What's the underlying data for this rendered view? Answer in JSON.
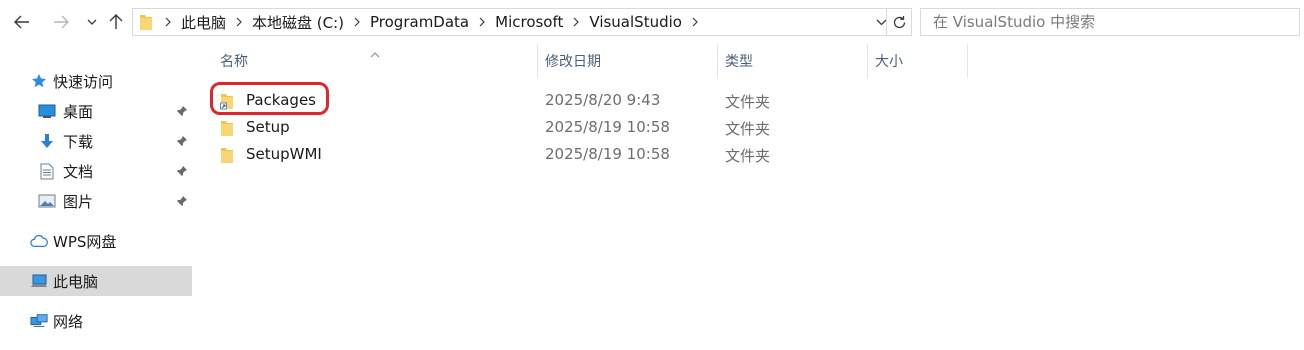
{
  "toolbar": {
    "back_icon": "back-arrow-icon",
    "forward_icon": "forward-arrow-icon",
    "recent_icon": "chevron-down-icon",
    "up_icon": "up-arrow-icon"
  },
  "address": {
    "crumbs": [
      "此电脑",
      "本地磁盘 (C:)",
      "ProgramData",
      "Microsoft",
      "VisualStudio"
    ]
  },
  "search": {
    "placeholder": "在 VisualStudio 中搜索"
  },
  "nav": {
    "quick_access": "快速访问",
    "desktop": "桌面",
    "downloads": "下载",
    "documents": "文档",
    "pictures": "图片",
    "wps": "WPS网盘",
    "this_pc": "此电脑",
    "network": "网络"
  },
  "columns": {
    "name": "名称",
    "modified": "修改日期",
    "type": "类型",
    "size": "大小"
  },
  "files": [
    {
      "name": "Packages",
      "modified": "2025/8/20 9:43",
      "type": "文件夹",
      "highlighted": true,
      "icon": "folder-shortcut-icon"
    },
    {
      "name": "Setup",
      "modified": "2025/8/19 10:58",
      "type": "文件夹",
      "highlighted": false,
      "icon": "folder-icon"
    },
    {
      "name": "SetupWMI",
      "modified": "2025/8/19 10:58",
      "type": "文件夹",
      "highlighted": false,
      "icon": "folder-icon"
    }
  ],
  "colors": {
    "highlight_border": "#e0262c",
    "selected_nav": "#d9d9d9",
    "folder": "#f2c44e",
    "header_text": "#4c607a"
  }
}
